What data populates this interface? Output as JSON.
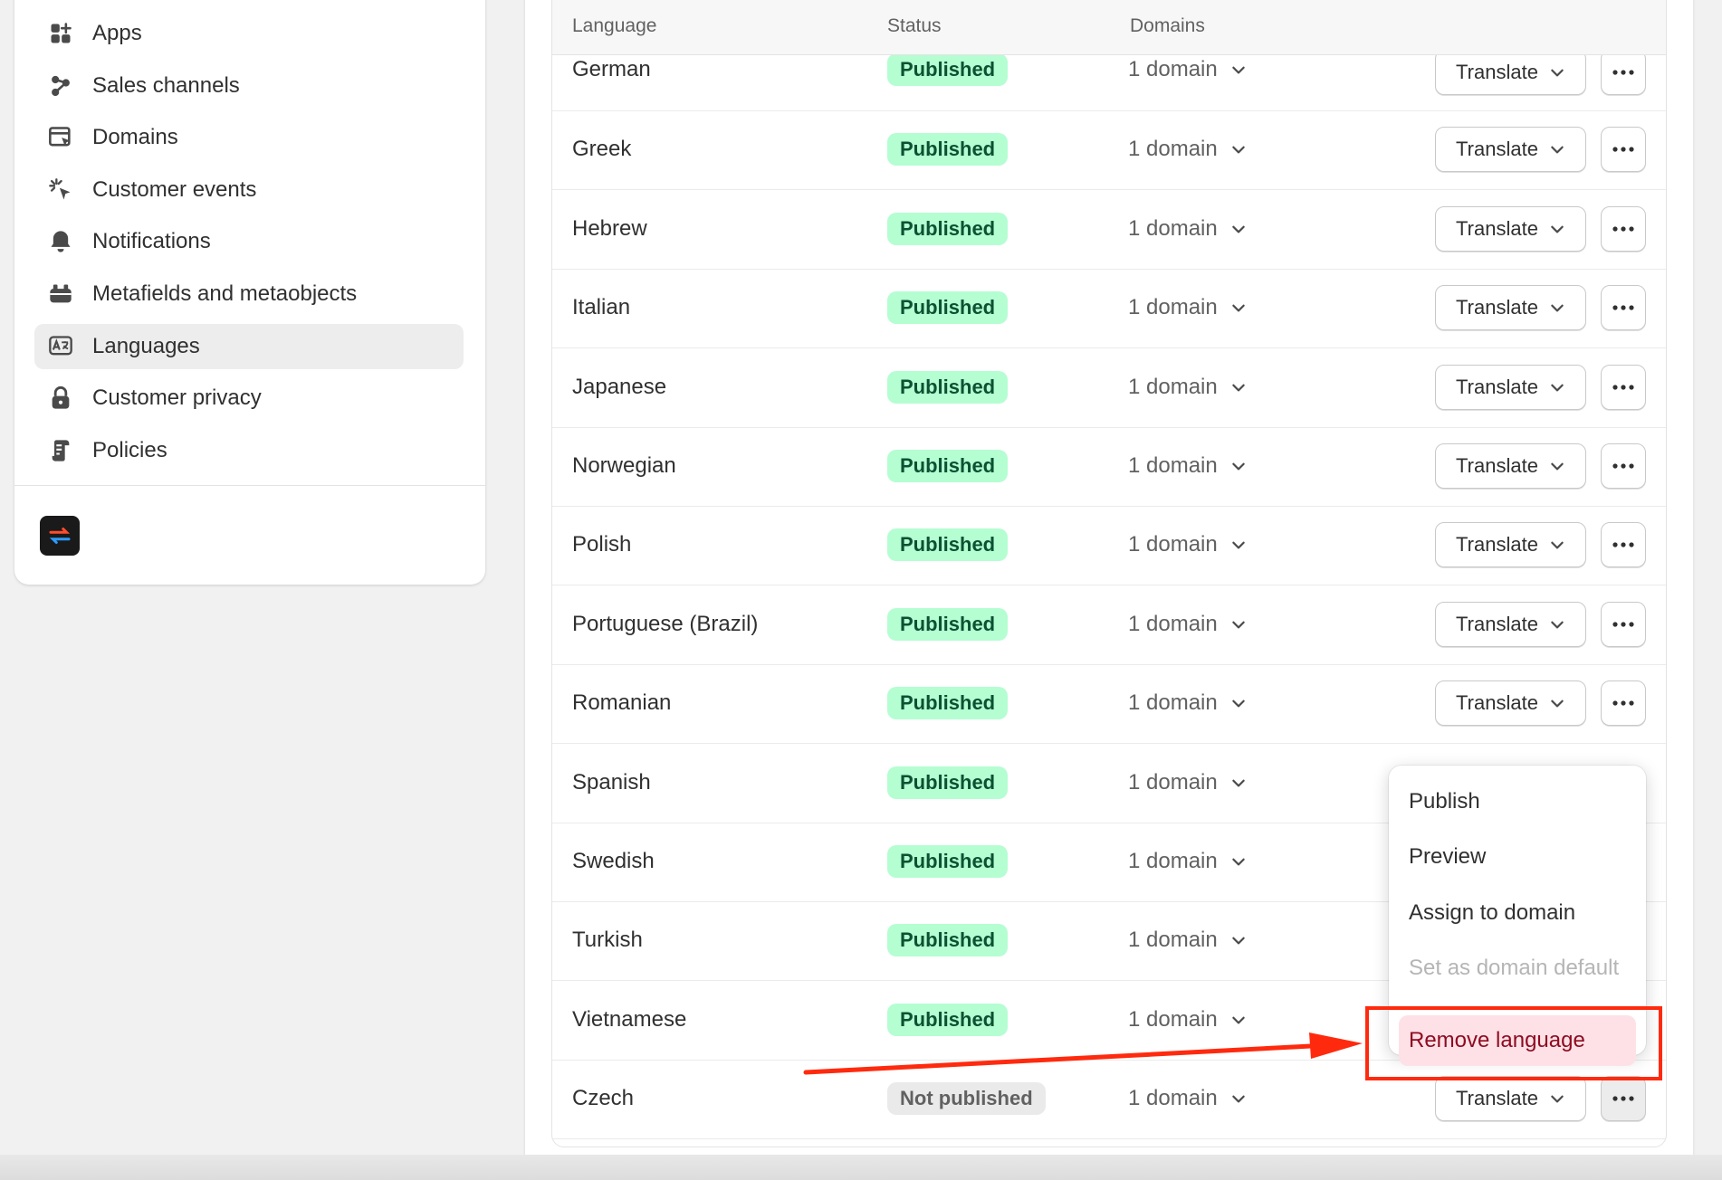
{
  "sidebar": {
    "items": [
      {
        "label": "Apps",
        "icon": "apps-icon"
      },
      {
        "label": "Sales channels",
        "icon": "sales-channels-icon"
      },
      {
        "label": "Domains",
        "icon": "domains-icon"
      },
      {
        "label": "Customer events",
        "icon": "customer-events-icon"
      },
      {
        "label": "Notifications",
        "icon": "bell-icon"
      },
      {
        "label": "Metafields and metaobjects",
        "icon": "metafields-icon"
      },
      {
        "label": "Languages",
        "icon": "languages-icon",
        "active": true
      },
      {
        "label": "Customer privacy",
        "icon": "lock-icon"
      },
      {
        "label": "Policies",
        "icon": "policies-icon"
      }
    ]
  },
  "table": {
    "headers": {
      "language": "Language",
      "status": "Status",
      "domains": "Domains"
    },
    "translate_label": "Translate",
    "rows": [
      {
        "language": "German",
        "status": "Published",
        "domains": "1 domain"
      },
      {
        "language": "Greek",
        "status": "Published",
        "domains": "1 domain"
      },
      {
        "language": "Hebrew",
        "status": "Published",
        "domains": "1 domain"
      },
      {
        "language": "Italian",
        "status": "Published",
        "domains": "1 domain"
      },
      {
        "language": "Japanese",
        "status": "Published",
        "domains": "1 domain"
      },
      {
        "language": "Norwegian",
        "status": "Published",
        "domains": "1 domain"
      },
      {
        "language": "Polish",
        "status": "Published",
        "domains": "1 domain"
      },
      {
        "language": "Portuguese (Brazil)",
        "status": "Published",
        "domains": "1 domain"
      },
      {
        "language": "Romanian",
        "status": "Published",
        "domains": "1 domain"
      },
      {
        "language": "Spanish",
        "status": "Published",
        "domains": "1 domain"
      },
      {
        "language": "Swedish",
        "status": "Published",
        "domains": "1 domain"
      },
      {
        "language": "Turkish",
        "status": "Published",
        "domains": "1 domain"
      },
      {
        "language": "Vietnamese",
        "status": "Published",
        "domains": "1 domain"
      },
      {
        "language": "Czech",
        "status": "Not published",
        "domains": "1 domain"
      }
    ]
  },
  "popover": {
    "publish": "Publish",
    "preview": "Preview",
    "assign": "Assign to domain",
    "set_default": "Set as domain default",
    "remove": "Remove language"
  },
  "colors": {
    "published_bg": "#b4fed2",
    "published_text": "#0c5132",
    "remove_bg": "#fee1e6",
    "remove_text": "#8e0b21",
    "annotation_red": "#ff2a0e"
  }
}
